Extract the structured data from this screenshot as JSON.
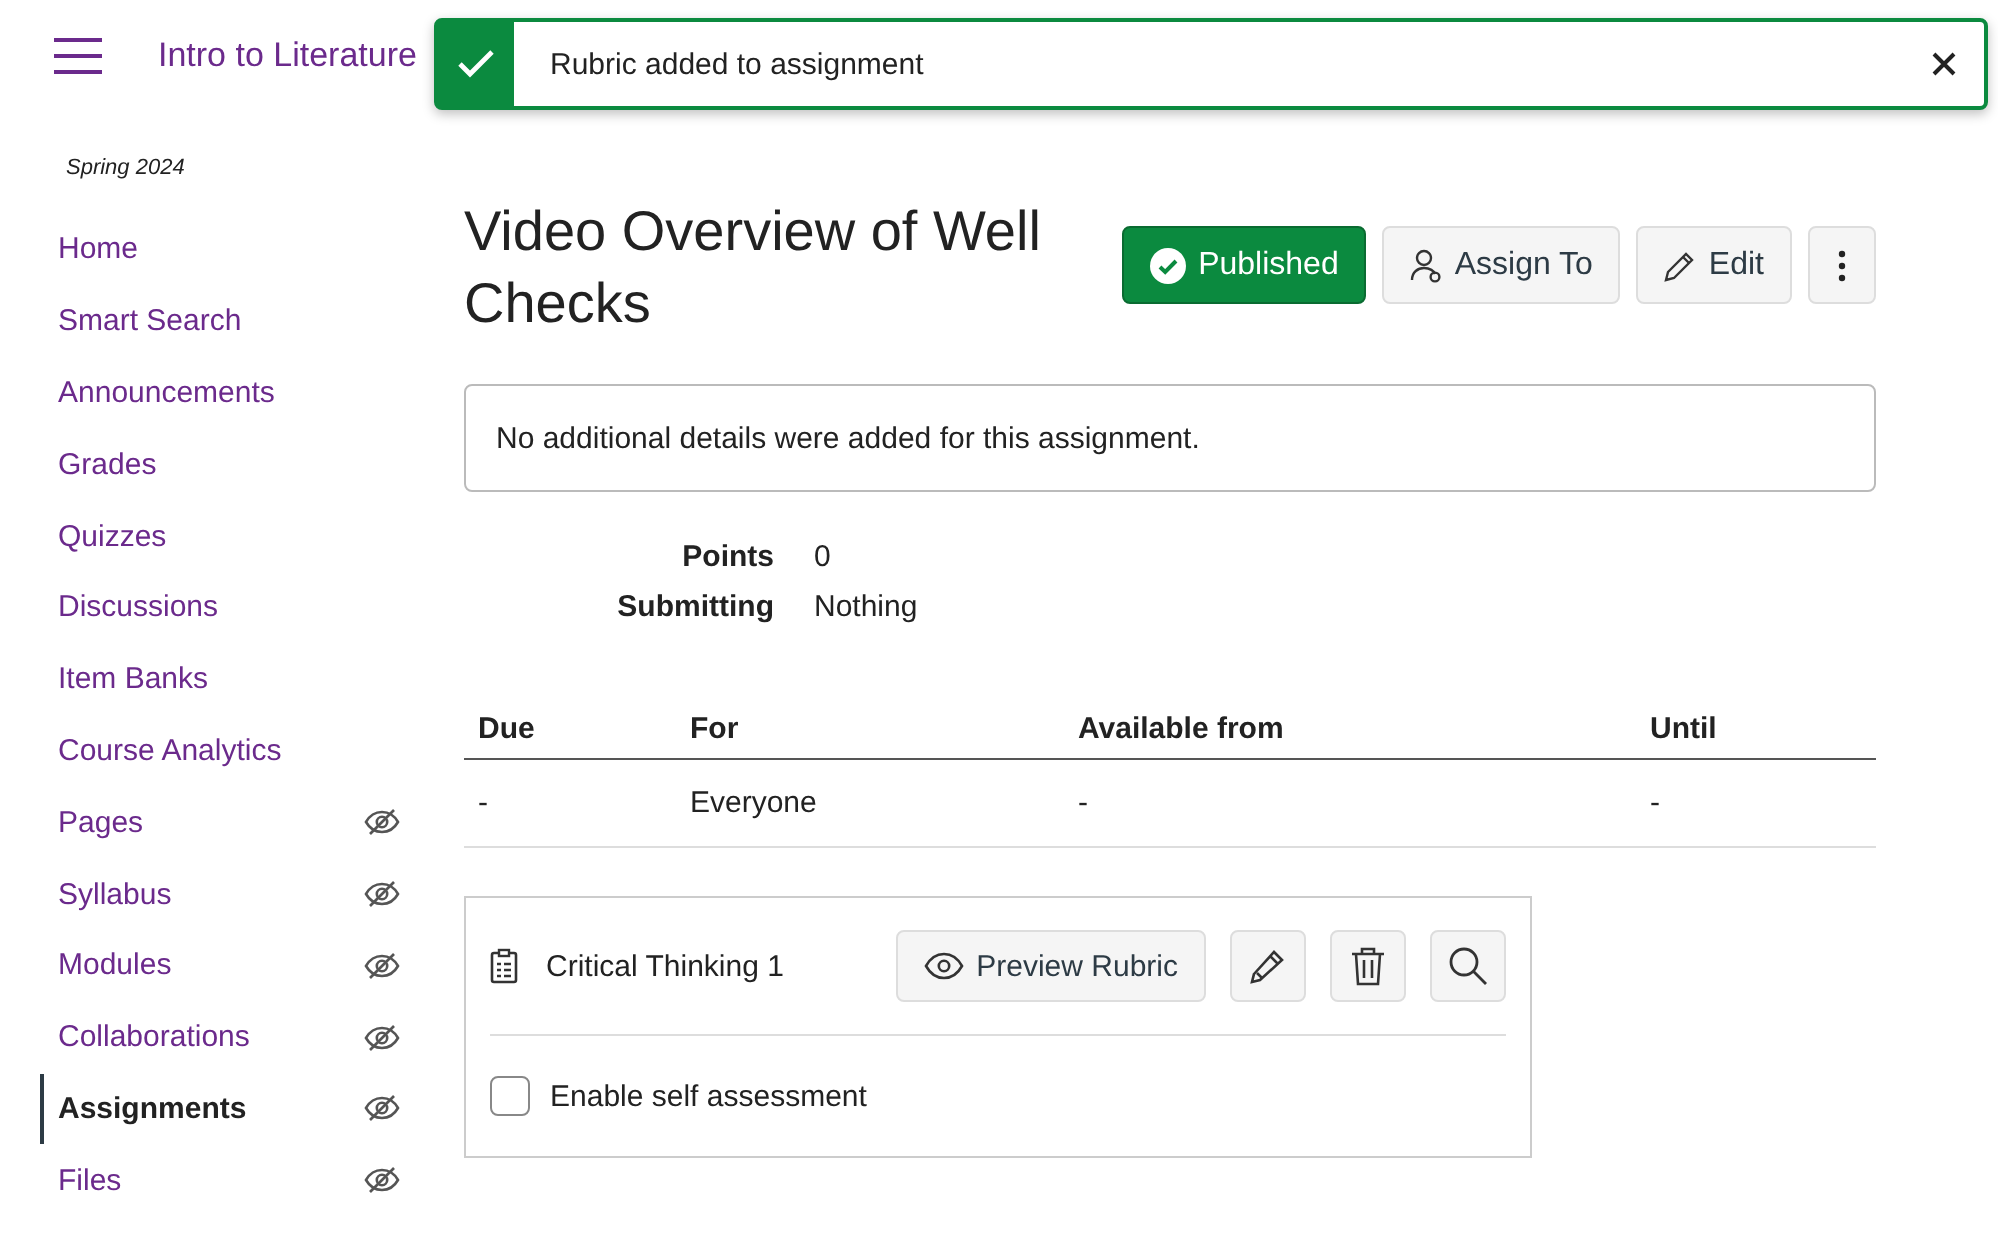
{
  "header": {
    "breadcrumb": "Intro to Literature"
  },
  "toast": {
    "message": "Rubric added to assignment"
  },
  "sidebar": {
    "term": "Spring 2024",
    "items": [
      {
        "label": "Home",
        "hidden": false,
        "selected": false
      },
      {
        "label": "Smart Search",
        "hidden": false,
        "selected": false
      },
      {
        "label": "Announcements",
        "hidden": false,
        "selected": false
      },
      {
        "label": "Grades",
        "hidden": false,
        "selected": false
      },
      {
        "label": "Quizzes",
        "hidden": false,
        "selected": false
      },
      {
        "label": "Discussions",
        "hidden": false,
        "selected": false
      },
      {
        "label": "Item Banks",
        "hidden": false,
        "selected": false
      },
      {
        "label": "Course Analytics",
        "hidden": false,
        "selected": false
      },
      {
        "label": "Pages",
        "hidden": true,
        "selected": false
      },
      {
        "label": "Syllabus",
        "hidden": true,
        "selected": false
      },
      {
        "label": "Modules",
        "hidden": true,
        "selected": false
      },
      {
        "label": "Collaborations",
        "hidden": true,
        "selected": false
      },
      {
        "label": "Assignments",
        "hidden": true,
        "selected": true
      },
      {
        "label": "Files",
        "hidden": true,
        "selected": false
      }
    ]
  },
  "assignment": {
    "title": "Video Overview of Well Checks",
    "published": true,
    "publish_label": "Published",
    "assign_label": "Assign To",
    "edit_label": "Edit",
    "description": "No additional details were added for this assignment.",
    "details": [
      {
        "label": "Points",
        "value": "0"
      },
      {
        "label": "Submitting",
        "value": "Nothing"
      }
    ],
    "dates": {
      "columns": [
        "Due",
        "For",
        "Available from",
        "Until"
      ],
      "rows": [
        [
          "-",
          "Everyone",
          "-",
          "-"
        ]
      ]
    },
    "rubric": {
      "name": "Critical Thinking 1",
      "preview_label": "Preview Rubric",
      "self_assessment_label": "Enable self assessment",
      "self_assessment_checked": false
    }
  }
}
